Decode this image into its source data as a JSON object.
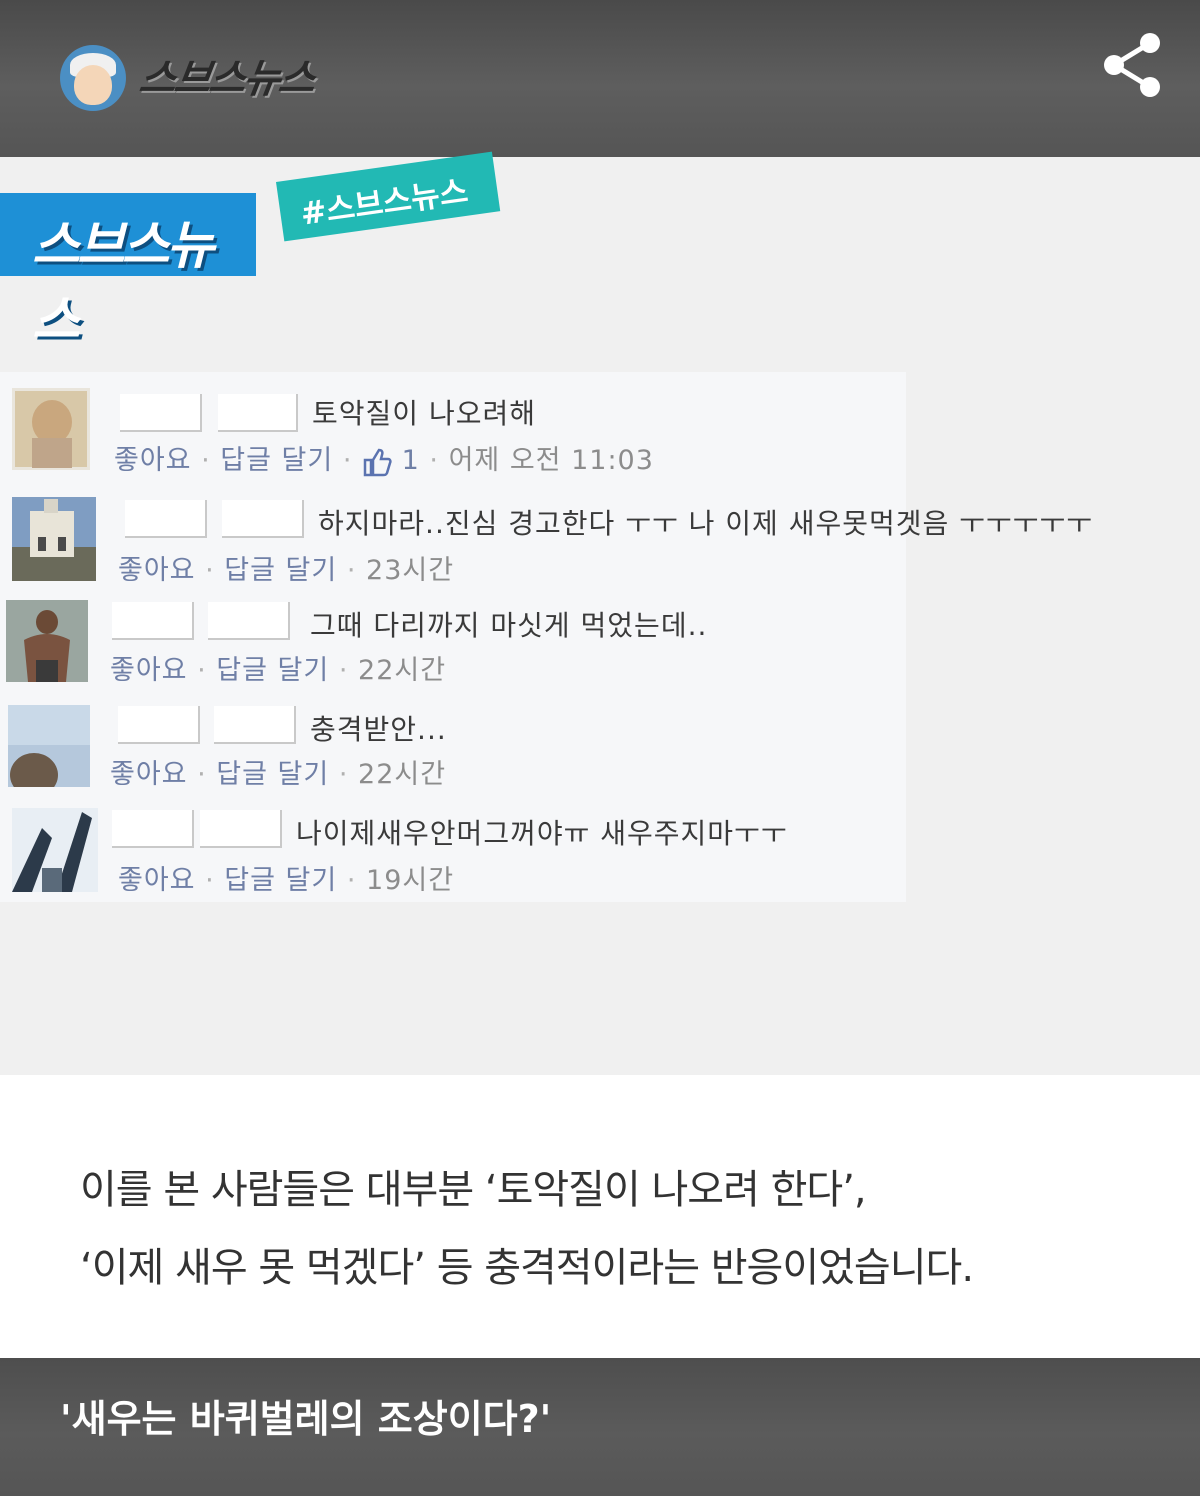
{
  "header": {
    "brand": "스브스뉴스",
    "share_icon": "share-icon"
  },
  "card": {
    "logo_text": "스브스뉴스",
    "hashtag": "#스브스뉴스"
  },
  "comments": [
    {
      "text": "토악질이 나오려해",
      "like": "좋아요",
      "reply": "답글 달기",
      "like_count": "1",
      "time": "어제 오전 11:03"
    },
    {
      "text": "하지마라..진심 경고한다 ㅜㅜ 나 이제 새우못먹겟음 ㅜㅜㅜㅜㅜ",
      "like": "좋아요",
      "reply": "답글 달기",
      "time": "23시간"
    },
    {
      "text": "그때 다리까지 마싯게 먹었는데..",
      "like": "좋아요",
      "reply": "답글 달기",
      "time": "22시간"
    },
    {
      "text": "충격받안...",
      "like": "좋아요",
      "reply": "답글 달기",
      "time": "22시간"
    },
    {
      "text": "나이제새우안머그꺼야ㅠ 새우주지마ㅜㅜ",
      "like": "좋아요",
      "reply": "답글 달기",
      "time": "19시간"
    }
  ],
  "article": {
    "line1": "이를 본 사람들은 대부분 ‘토악질이 나오려 한다’,",
    "line2": "‘이제 새우 못 먹겠다’ 등 충격적이라는 반응이었습니다."
  },
  "footer": {
    "caption": "'새우는 바퀴벌레의 조상이다?'"
  },
  "colors": {
    "logo_blue": "#1e90d6",
    "tag_teal": "#22b9b4",
    "bar_gray": "#555555"
  }
}
